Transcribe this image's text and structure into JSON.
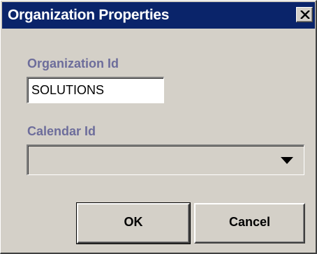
{
  "window": {
    "title": "Organization Properties"
  },
  "form": {
    "organization_id": {
      "label": "Organization Id",
      "value": "SOLUTIONS"
    },
    "calendar_id": {
      "label": "Calendar Id",
      "selected": ""
    }
  },
  "buttons": {
    "ok_label": "OK",
    "cancel_label": "Cancel"
  },
  "icons": {
    "close": "close-icon",
    "dropdown": "chevron-down-icon"
  },
  "colors": {
    "titlebar": "#0a246a",
    "label": "#6d6d9b",
    "face": "#d4d0c8"
  }
}
